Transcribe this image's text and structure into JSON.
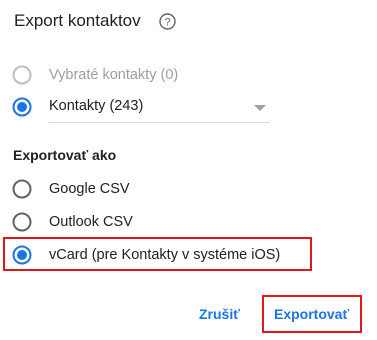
{
  "dialog": {
    "title": "Export kontaktov",
    "help_icon": "help-circle-icon"
  },
  "source": {
    "options": [
      {
        "label": "Vybraté kontakty (0)",
        "selected": false,
        "disabled": true
      },
      {
        "label": "Kontakty (243)",
        "selected": true,
        "disabled": false
      }
    ],
    "dropdown_icon": "caret-down-icon"
  },
  "export_as": {
    "label": "Exportovať ako",
    "options": [
      {
        "label": "Google CSV",
        "selected": false
      },
      {
        "label": "Outlook CSV",
        "selected": false
      },
      {
        "label": "vCard (pre Kontakty v systéme iOS)",
        "selected": true
      }
    ]
  },
  "actions": {
    "cancel_label": "Zrušiť",
    "export_label": "Exportovať"
  },
  "colors": {
    "accent": "#1a73e8",
    "highlight": "#e3161b",
    "disabled": "#bdbdbd",
    "radio_unselected": "#5f6368"
  }
}
